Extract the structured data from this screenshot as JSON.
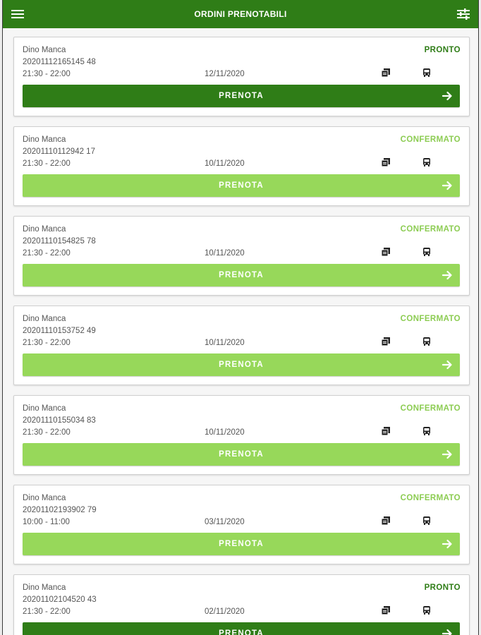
{
  "header": {
    "title": "ORDINI PRENOTABILI"
  },
  "colors": {
    "header": "#2f7d17",
    "dark_button": "#2f7d17",
    "light_button": "#97d85a",
    "status_pronto": "#2f7d17",
    "status_confermato": "#8ccc52"
  },
  "icons": {
    "menu": "menu-icon",
    "filter": "filter-sliders-icon",
    "copy": "copy-icon",
    "vehicle": "bus-icon",
    "arrow": "arrow-right-icon"
  },
  "cards": [
    {
      "name": "Dino Manca",
      "code": "20201112165145 48",
      "time": "21:30 - 22:00",
      "date": "12/11/2020",
      "status": "PRONTO",
      "button": "PRENOTA"
    },
    {
      "name": "Dino Manca",
      "code": "20201110112942 17",
      "time": "21:30 - 22:00",
      "date": "10/11/2020",
      "status": "CONFERMATO",
      "button": "PRENOTA"
    },
    {
      "name": "Dino Manca",
      "code": "20201110154825 78",
      "time": "21:30 - 22:00",
      "date": "10/11/2020",
      "status": "CONFERMATO",
      "button": "PRENOTA"
    },
    {
      "name": "Dino Manca",
      "code": "20201110153752 49",
      "time": "21:30 - 22:00",
      "date": "10/11/2020",
      "status": "CONFERMATO",
      "button": "PRENOTA"
    },
    {
      "name": "Dino Manca",
      "code": "20201110155034 83",
      "time": "21:30 - 22:00",
      "date": "10/11/2020",
      "status": "CONFERMATO",
      "button": "PRENOTA"
    },
    {
      "name": "Dino Manca",
      "code": "20201102193902 79",
      "time": "10:00 - 11:00",
      "date": "03/11/2020",
      "status": "CONFERMATO",
      "button": "PRENOTA"
    },
    {
      "name": "Dino Manca",
      "code": "20201102104520 43",
      "time": "21:30 - 22:00",
      "date": "02/11/2020",
      "status": "PRONTO",
      "button": "PRENOTA"
    }
  ]
}
